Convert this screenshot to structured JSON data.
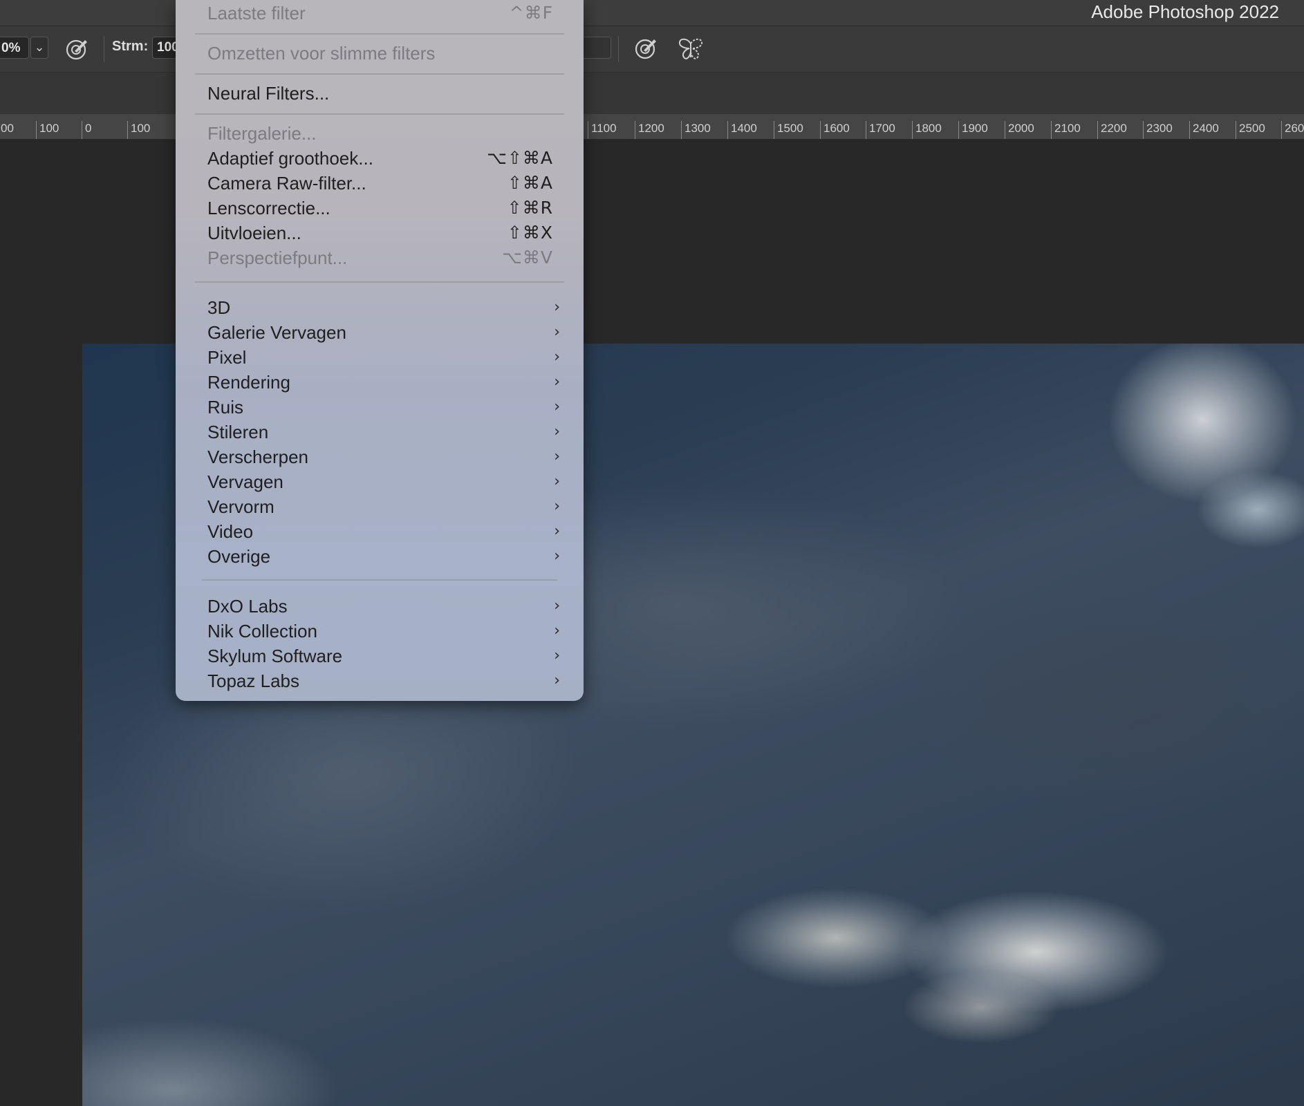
{
  "window": {
    "title": "Adobe Photoshop 2022"
  },
  "options_bar": {
    "zoom_value": "0%",
    "zoom_dropdown_glyph": "⌄",
    "strength_label": "Strm:",
    "strength_value": "100"
  },
  "ruler": {
    "ticks": [
      "00",
      "100",
      "0",
      "100",
      "1100",
      "1200",
      "1300",
      "1400",
      "1500",
      "1600",
      "1700",
      "1800",
      "1900",
      "2000",
      "2100",
      "2200",
      "2300",
      "2400",
      "2500",
      "260"
    ]
  },
  "menu": {
    "items": [
      {
        "label": "Laatste filter",
        "shortcut": "^⌘F",
        "disabled": true
      },
      {
        "label": "Omzetten voor slimme filters",
        "disabled": true
      },
      {
        "label": "Neural Filters...",
        "disabled": false
      },
      {
        "label": "Filtergalerie...",
        "disabled": true
      },
      {
        "label": "Adaptief groothoek...",
        "shortcut": "⌥⇧⌘A",
        "disabled": false
      },
      {
        "label": "Camera Raw-filter...",
        "shortcut": "⇧⌘A",
        "disabled": false
      },
      {
        "label": "Lenscorrectie...",
        "shortcut": "⇧⌘R",
        "disabled": false
      },
      {
        "label": "Uitvloeien...",
        "shortcut": "⇧⌘X",
        "disabled": false
      },
      {
        "label": "Perspectiefpunt...",
        "shortcut": "⌥⌘V",
        "disabled": true
      },
      {
        "label": "3D",
        "submenu": true
      },
      {
        "label": "Galerie Vervagen",
        "submenu": true
      },
      {
        "label": "Pixel",
        "submenu": true
      },
      {
        "label": "Rendering",
        "submenu": true
      },
      {
        "label": "Ruis",
        "submenu": true
      },
      {
        "label": "Stileren",
        "submenu": true
      },
      {
        "label": "Verscherpen",
        "submenu": true
      },
      {
        "label": "Vervagen",
        "submenu": true
      },
      {
        "label": "Vervorm",
        "submenu": true
      },
      {
        "label": "Video",
        "submenu": true
      },
      {
        "label": "Overige",
        "submenu": true
      },
      {
        "label": "DxO Labs",
        "submenu": true
      },
      {
        "label": "Nik Collection",
        "submenu": true
      },
      {
        "label": "Skylum Software",
        "submenu": true
      },
      {
        "label": "Topaz Labs",
        "submenu": true
      }
    ],
    "submenu_arrow": "›"
  },
  "icons": {
    "brush_target": "brush-target-icon",
    "brush_target_2": "brush-target-icon",
    "butterfly": "butterfly-icon"
  },
  "colors": {
    "app_bg": "#282828",
    "menu_bg_top": "#b9b6bb",
    "menu_bg_bottom": "#a6b0c5",
    "disabled_text": "#7c7b80"
  }
}
